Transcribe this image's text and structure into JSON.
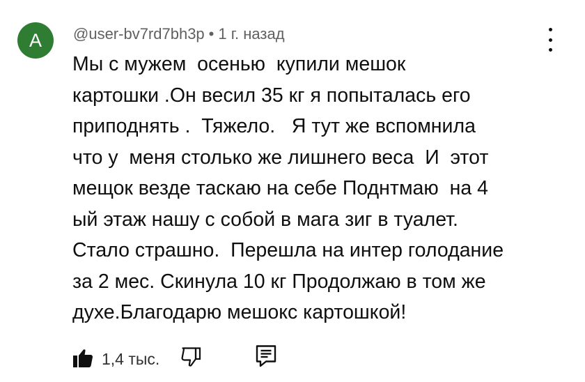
{
  "comment": {
    "avatar_letter": "A",
    "author": "@user-bv7rd7bh3p",
    "separator": "•",
    "time": "1 г. назад",
    "text_lines": [
      "Мы с мужем  осенью  купили мешок",
      "картошки .Он весил 35 кг я попыталась его",
      "приподнять .  Тяжело.   Я тут же вспомнила",
      "что у  меня столько же лишнего веса  И  этот",
      "мещок везде таскаю на себе Поднтмаю  на 4",
      "ый этаж нашу с собой в мага зиг в туалет.",
      "Стало страшно.  Перешла на интер голодание",
      "за 2 мес. Скинула 10 кг Продолжаю в том же",
      "духе.Благодарю мешокс картошкой!"
    ]
  },
  "actions": {
    "like_count": "1,4 тыс."
  },
  "icons": {
    "like": "thumbs-up-icon",
    "dislike": "thumbs-down-icon",
    "reply": "reply-comment-icon",
    "menu": "more-vert-icon"
  },
  "colors": {
    "avatar_bg": "#2e7d32",
    "meta_text": "#606060",
    "body_text": "#0f0f0f"
  }
}
